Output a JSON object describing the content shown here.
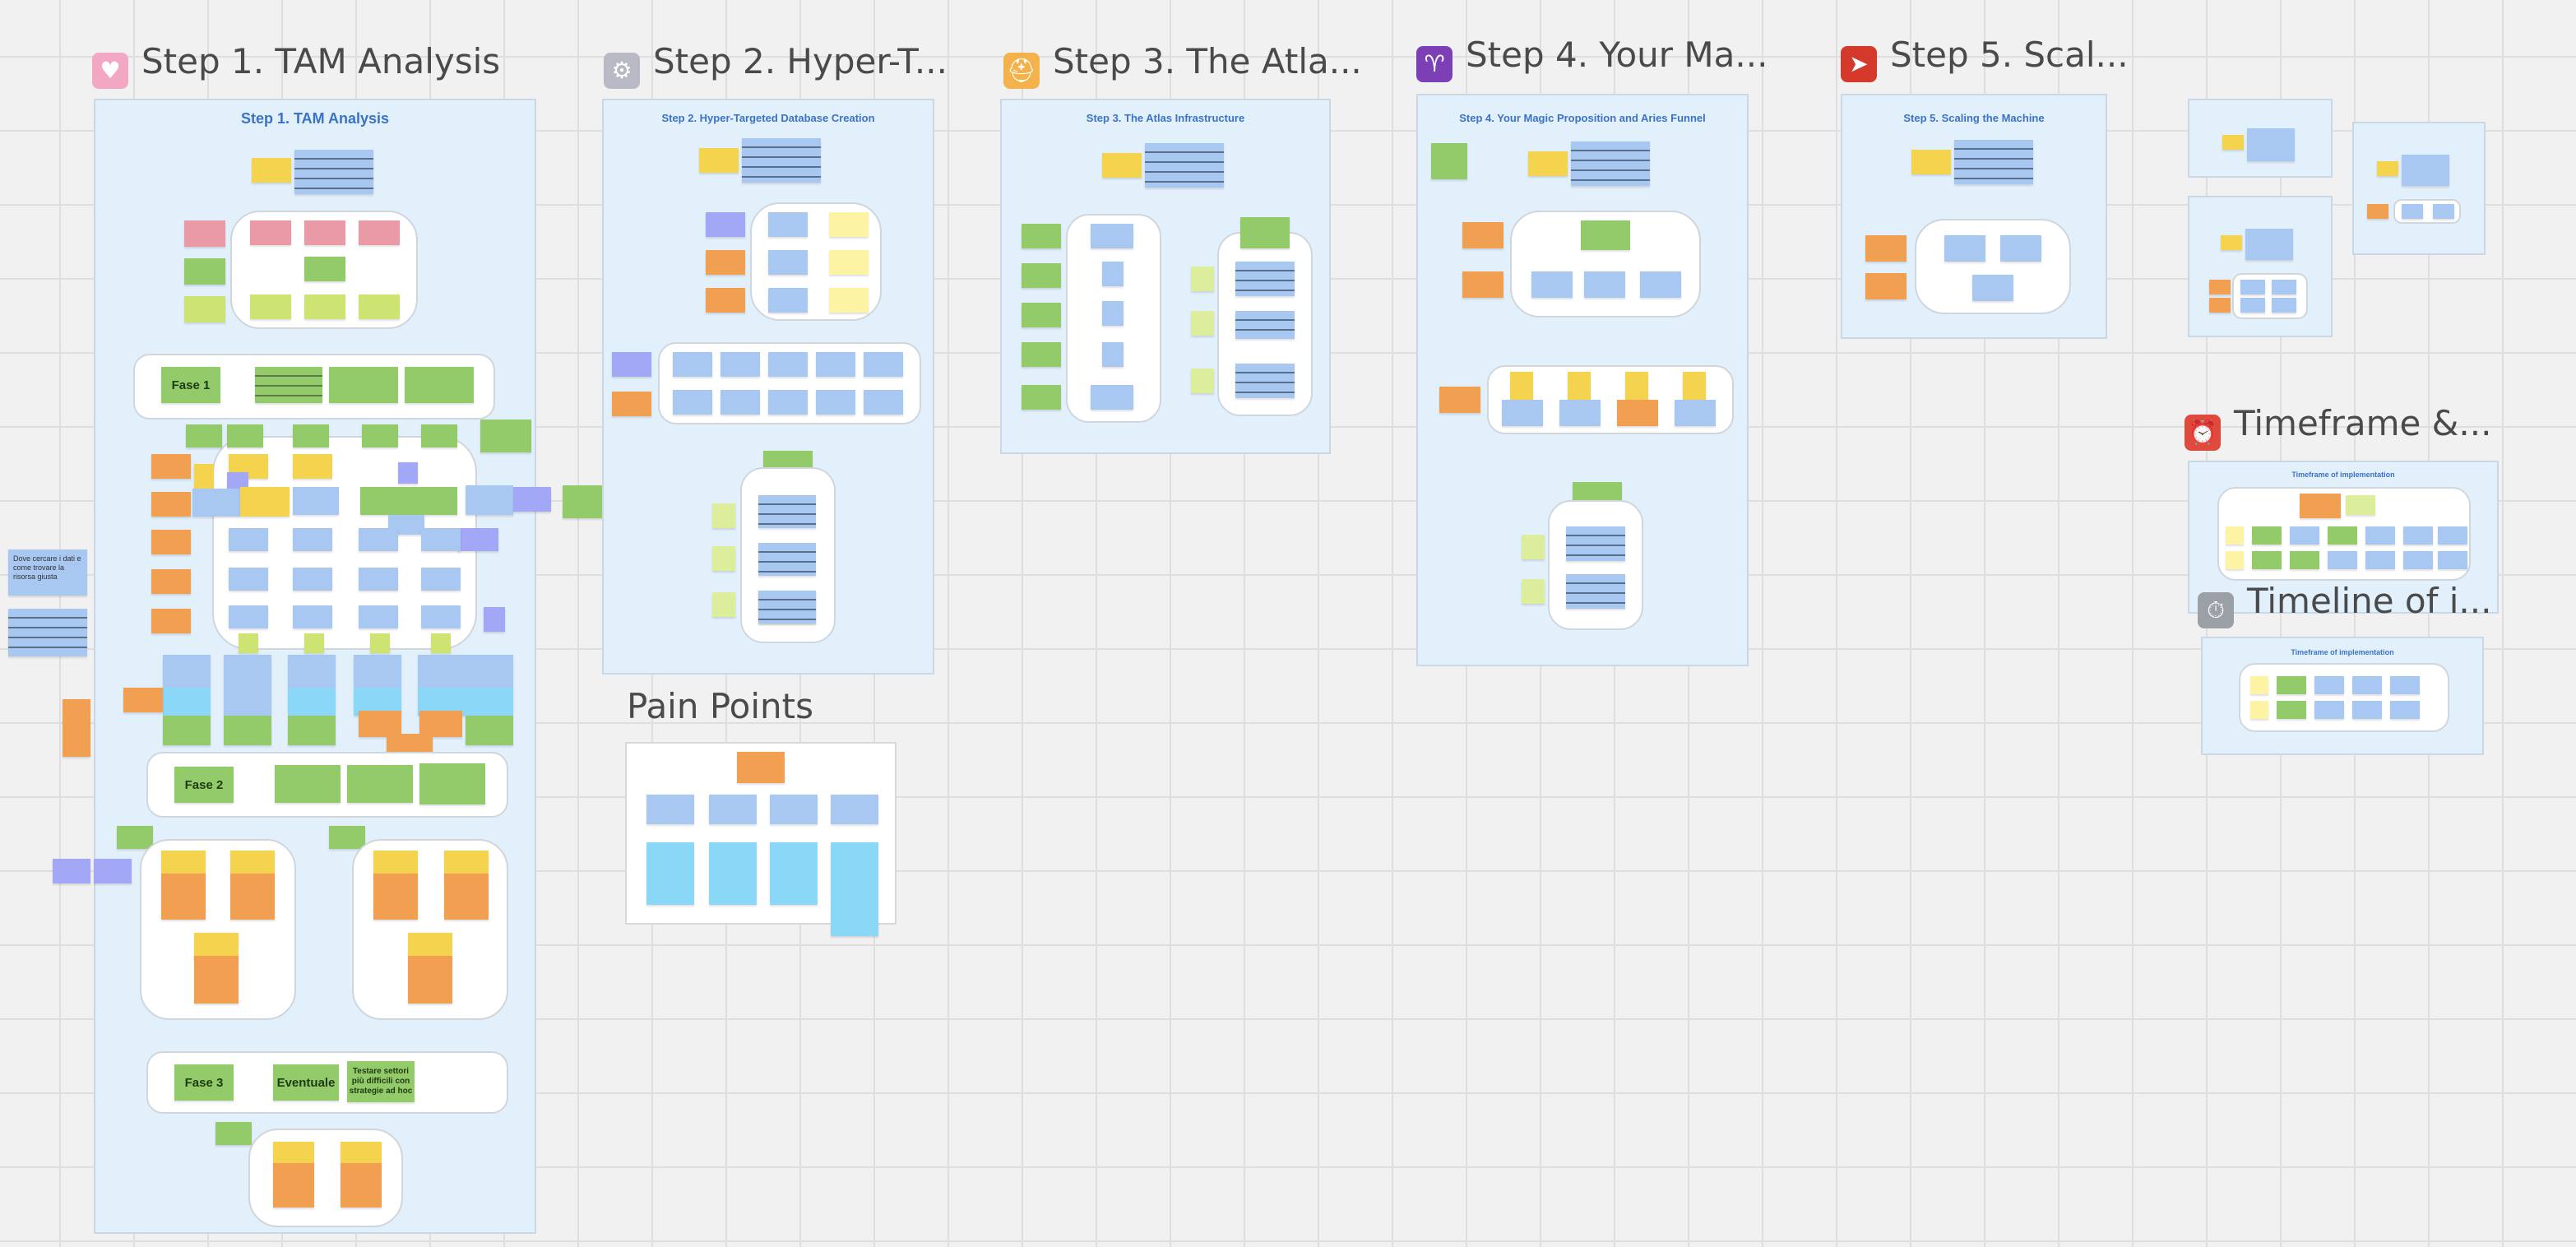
{
  "frames": {
    "step1": {
      "title": "Step 1. TAM Analysis",
      "inner_title": "Step 1. TAM Analysis",
      "icon": "couple-emoji-icon"
    },
    "step2": {
      "title": "Step 2. Hyper-T...",
      "inner_title": "Step 2. Hyper-Targeted Database Creation",
      "icon": "robot-emoji-icon"
    },
    "step3": {
      "title": "Step 3. The Atla...",
      "inner_title": "Step 3. The Atlas Infrastructure",
      "icon": "construction-worker-emoji-icon"
    },
    "step4": {
      "title": "Step 4. Your Ma...",
      "inner_title": "Step 4. Your Magic Proposition and Aries Funnel",
      "icon": "aries-sign-icon"
    },
    "step5": {
      "title": "Step 5. Scal...",
      "inner_title": "Step 5. Scaling the Machine",
      "icon": "race-car-emoji-icon"
    },
    "pain": {
      "title": "Pain Points"
    },
    "timeframe": {
      "title": "Timeframe &...",
      "inner_title": "Timeframe of implementation",
      "icon": "alarm-clock-icon"
    },
    "timeline": {
      "title": "Timeline of i...",
      "inner_title": "Timeframe of implementation",
      "icon": "stopwatch-icon"
    }
  },
  "phases": {
    "fase1": {
      "label": "Fase 1"
    },
    "fase2": {
      "label": "Fase 2"
    },
    "fase3": {
      "label": "Fase 3",
      "eventuale": "Eventuale",
      "note": "Testare settori più difficili con strategie ad hoc"
    }
  },
  "notes": {
    "side_note": "Dove cercare i dati e come trovare la risorsa giusta"
  },
  "colors": {
    "yellow": "#f4d44e",
    "green": "#94cb6a",
    "orange": "#f0a050",
    "blue": "#a8c8f2",
    "pink": "#ea9aa6",
    "lime": "#cde473",
    "purple": "#a2a8f5",
    "cyan": "#8ad7f7",
    "frame_bg": "#e2f0fb",
    "inner_title": "#3b72c7",
    "canvas": "#f1f1f1"
  }
}
